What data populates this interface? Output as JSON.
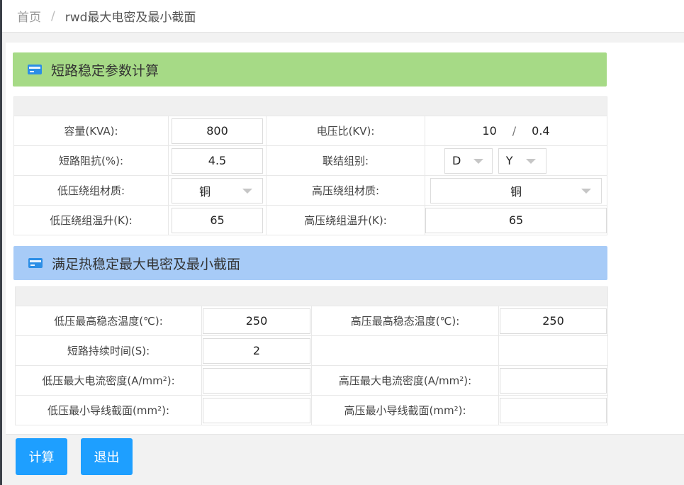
{
  "breadcrumb": {
    "home": "首页",
    "separator": "/",
    "current": "rwd最大电密及最小截面"
  },
  "panel1": {
    "title": "短路稳定参数计算",
    "capacity_label": "容量(KVA):",
    "capacity_value": "800",
    "voltage_ratio_label": "电压比(KV):",
    "voltage_high": "10",
    "voltage_sep": "/",
    "voltage_low": "0.4",
    "impedance_label": "短路阻抗(%):",
    "impedance_value": "4.5",
    "group_label": "联结组别:",
    "group_high": "D",
    "group_low": "Y",
    "lv_material_label": "低压绕组材质:",
    "lv_material_value": "铜",
    "hv_material_label": "高压绕组材质:",
    "hv_material_value": "铜",
    "lv_temp_rise_label": "低压绕组温升(K):",
    "lv_temp_rise_value": "65",
    "hv_temp_rise_label": "高压绕组温升(K):",
    "hv_temp_rise_value": "65"
  },
  "panel2": {
    "title": "满足热稳定最大电密及最小截面",
    "lv_max_temp_label": "低压最高稳态温度(℃):",
    "lv_max_temp_value": "250",
    "hv_max_temp_label": "高压最高稳态温度(℃):",
    "hv_max_temp_value": "250",
    "duration_label": "短路持续时间(S):",
    "duration_value": "2",
    "lv_max_density_label": "低压最大电流密度(A/mm²):",
    "lv_max_density_value": "",
    "hv_max_density_label": "高压最大电流密度(A/mm²):",
    "hv_max_density_value": "",
    "lv_min_section_label": "低压最小导线截面(mm²):",
    "lv_min_section_value": "",
    "hv_min_section_label": "高压最小导线截面(mm²):",
    "hv_min_section_value": ""
  },
  "buttons": {
    "calculate": "计算",
    "exit": "退出"
  },
  "colors": {
    "primary": "#1e9fff",
    "panel1_header": "#a6da86",
    "panel2_header": "#a7cbf7"
  }
}
